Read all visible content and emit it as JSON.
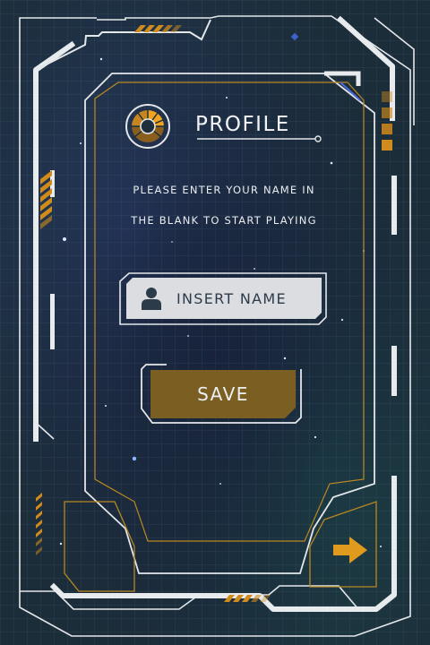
{
  "profile": {
    "title": "PROFILE",
    "instruction_line1": "PLEASE ENTER YOUR NAME IN",
    "instruction_line2": "THE BLANK TO START PLAYING"
  },
  "name_input": {
    "placeholder": "INSERT NAME",
    "value": ""
  },
  "save_button": {
    "label": "SAVE"
  },
  "icons": {
    "avatar": "gauge-dial-icon",
    "user": "user-icon",
    "next": "arrow-right-icon"
  },
  "colors": {
    "accent": "#f0a31e",
    "frame": "#e4e7ea",
    "button": "#7a5e22",
    "input": "#dcdde1"
  }
}
